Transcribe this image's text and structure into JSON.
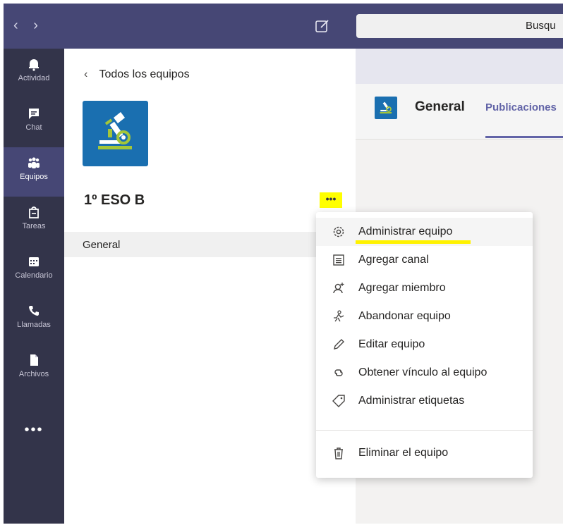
{
  "topbar": {
    "back_arrow": "‹",
    "forward_arrow": "›",
    "search_placeholder": "Busqu"
  },
  "rail": {
    "items": [
      {
        "label": "Actividad",
        "icon": "bell-icon"
      },
      {
        "label": "Chat",
        "icon": "chat-icon"
      },
      {
        "label": "Equipos",
        "icon": "teams-icon",
        "active": true
      },
      {
        "label": "Tareas",
        "icon": "assignments-icon"
      },
      {
        "label": "Calendario",
        "icon": "calendar-icon"
      },
      {
        "label": "Llamadas",
        "icon": "phone-icon"
      },
      {
        "label": "Archivos",
        "icon": "files-icon"
      }
    ],
    "more": "•••"
  },
  "panel": {
    "back_label": "Todos los equipos",
    "team_name": "1º ESO B",
    "more_button": "•••",
    "channels": [
      "General"
    ]
  },
  "channel_header": {
    "title": "General",
    "tab": "Publicaciones"
  },
  "menu": {
    "items": [
      {
        "label": "Administrar equipo",
        "icon": "gear-icon"
      },
      {
        "label": "Agregar canal",
        "icon": "add-channel-icon"
      },
      {
        "label": "Agregar miembro",
        "icon": "add-member-icon"
      },
      {
        "label": "Abandonar equipo",
        "icon": "leave-icon"
      },
      {
        "label": "Editar equipo",
        "icon": "pencil-icon"
      },
      {
        "label": "Obtener vínculo al equipo",
        "icon": "link-icon"
      },
      {
        "label": "Administrar etiquetas",
        "icon": "tag-icon"
      }
    ],
    "delete_label": "Eliminar el equipo"
  },
  "colors": {
    "brand": "#464775",
    "rail": "#33344a",
    "accent": "#6264a7",
    "highlight": "#ffff00",
    "team_logo": "#1a6fb0"
  }
}
